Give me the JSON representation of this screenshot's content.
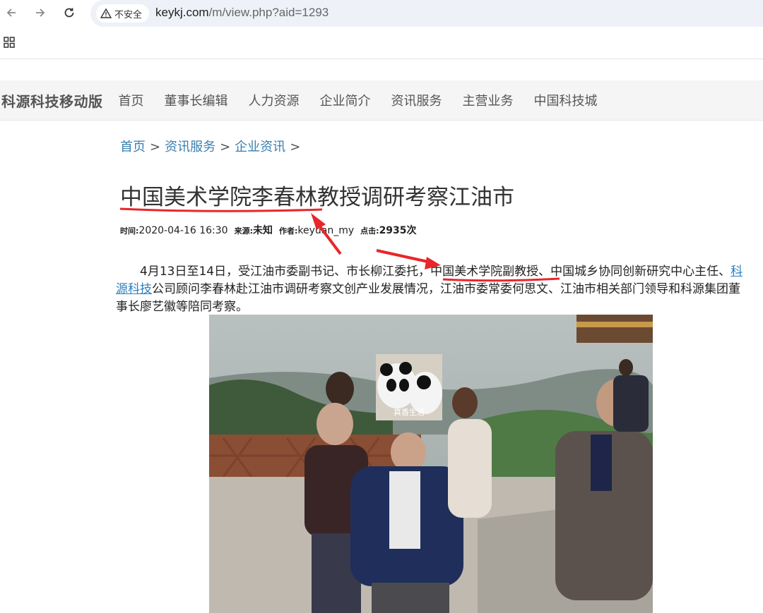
{
  "browser": {
    "security_label": "不安全",
    "url_host": "keykj.com",
    "url_path": "/m/view.php?aid=1293"
  },
  "site": {
    "logo": "科源科技移动版",
    "nav": [
      "首页",
      "董事长编辑",
      "人力资源",
      "企业简介",
      "资讯服务",
      "主营业务",
      "中国科技城"
    ]
  },
  "breadcrumb": {
    "items": [
      "首页",
      "资讯服务",
      "企业资讯"
    ],
    "separator": ">"
  },
  "article": {
    "title": "中国美术学院李春林教授调研考察江油市",
    "meta": {
      "time_label": "时间:",
      "time_value": "2020-04-16 16:30",
      "source_label": "来源:",
      "source_value": "未知",
      "author_label": "作者:",
      "author_value": "keyuan_my",
      "clicks_label": "点击:",
      "clicks_value": "2935次"
    },
    "body": {
      "part1": "4月13日至14日，受江油市委副书记、市长柳江委托，",
      "highlight": "中国美术学院副教授",
      "part2": "、中国城乡协同创新研究中心主任、",
      "link": "科源科技",
      "part3": "公司顾问李春林赴江油市调研考察文创产业发展情况，江油市委常委何思文、江油市相关部门领导和科源集团董事长廖艺徽等陪同考察。"
    },
    "photo_watermark": "真香生活"
  },
  "colors": {
    "annotation_red": "#e8262b",
    "link_blue": "#2b7fc1",
    "nav_bg": "#f5f5f5"
  }
}
